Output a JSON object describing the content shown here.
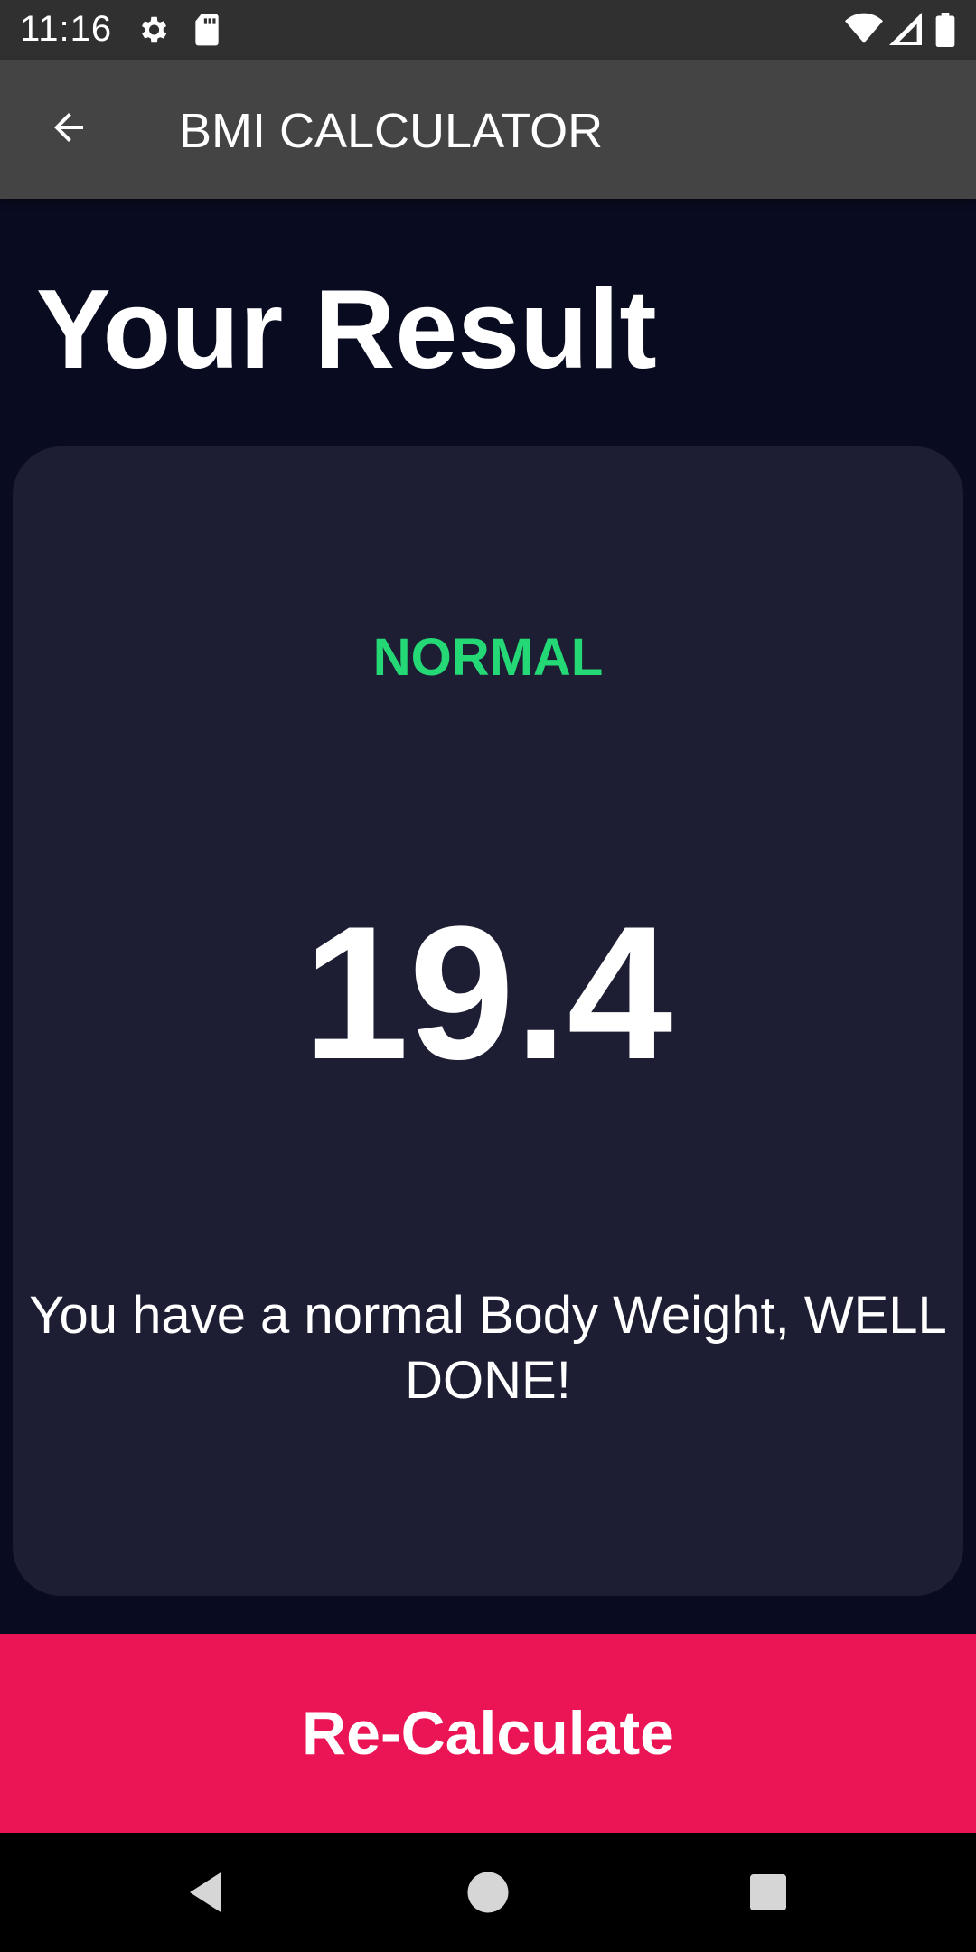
{
  "status_bar": {
    "time": "11:16",
    "icons": [
      "settings-icon",
      "sd-card-icon",
      "wifi-icon",
      "signal-icon",
      "battery-icon"
    ]
  },
  "app_bar": {
    "back_icon": "arrow-back-icon",
    "title": "BMI CALCULATOR"
  },
  "page": {
    "title": "Your Result"
  },
  "result": {
    "status": "NORMAL",
    "status_color": "#24d876",
    "value": "19.4",
    "message": "You have a normal Body Weight, WELL DONE!"
  },
  "action": {
    "label": "Re-Calculate",
    "color": "#eb1555"
  },
  "nav_bar": {
    "icons": [
      "back-triangle-icon",
      "home-circle-icon",
      "recents-square-icon"
    ]
  }
}
